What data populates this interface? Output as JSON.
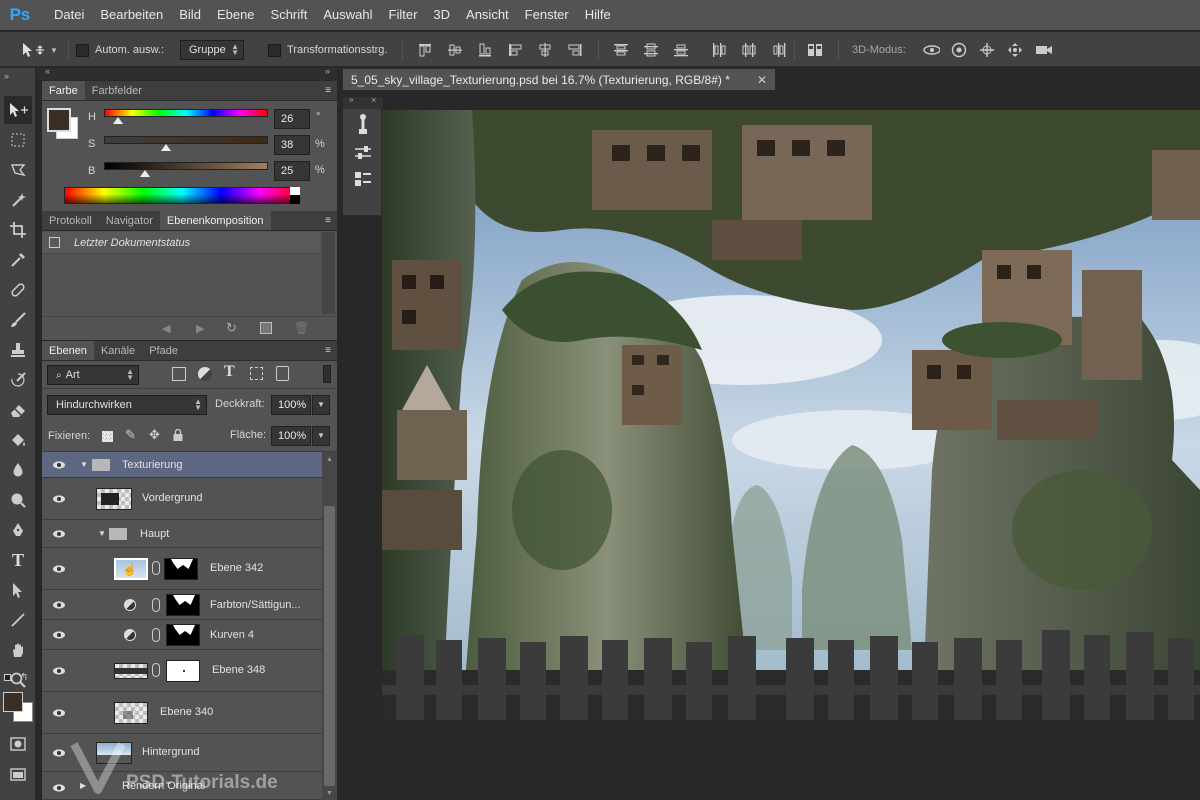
{
  "app": {
    "logo": "Ps"
  },
  "menu": [
    "Datei",
    "Bearbeiten",
    "Bild",
    "Ebene",
    "Schrift",
    "Auswahl",
    "Filter",
    "3D",
    "Ansicht",
    "Fenster",
    "Hilfe"
  ],
  "options": {
    "auto_select_label": "Autom. ausw.:",
    "auto_select_value": "Gruppe",
    "transform_label": "Transformationsstrg.",
    "mode3d_label": "3D-Modus:"
  },
  "color_panel": {
    "tabs": [
      "Farbe",
      "Farbfelder"
    ],
    "sliders": [
      {
        "label": "H",
        "value": "26",
        "unit": "°"
      },
      {
        "label": "S",
        "value": "38",
        "unit": "%"
      },
      {
        "label": "B",
        "value": "25",
        "unit": "%"
      }
    ],
    "foreground": "#3b2e24",
    "background": "#ffffff"
  },
  "history_panel": {
    "tabs": [
      "Protokoll",
      "Navigator",
      "Ebenenkomposition"
    ],
    "item": "Letzter Dokumentstatus"
  },
  "layers_panel": {
    "tabs": [
      "Ebenen",
      "Kanäle",
      "Pfade"
    ],
    "filter": "Art",
    "blend_mode": "Hindurchwirken",
    "opacity_label": "Deckkraft:",
    "opacity": "100%",
    "lock_label": "Fixieren:",
    "fill_label": "Fläche:",
    "fill": "100%",
    "layers": [
      {
        "name": "Texturierung"
      },
      {
        "name": "Vordergrund"
      },
      {
        "name": "Haupt"
      },
      {
        "name": "Ebene 342"
      },
      {
        "name": "Farbton/Sättigun..."
      },
      {
        "name": "Kurven 4"
      },
      {
        "name": "Ebene 348"
      },
      {
        "name": "Ebene 340"
      },
      {
        "name": "Hintergrund"
      },
      {
        "name": "Rendern Original"
      }
    ]
  },
  "document": {
    "tab_title": "5_05_sky_village_Texturierung.psd bei 16.7% (Texturierung, RGB/8#) *"
  },
  "watermark": "PSD-Tutorials.de"
}
